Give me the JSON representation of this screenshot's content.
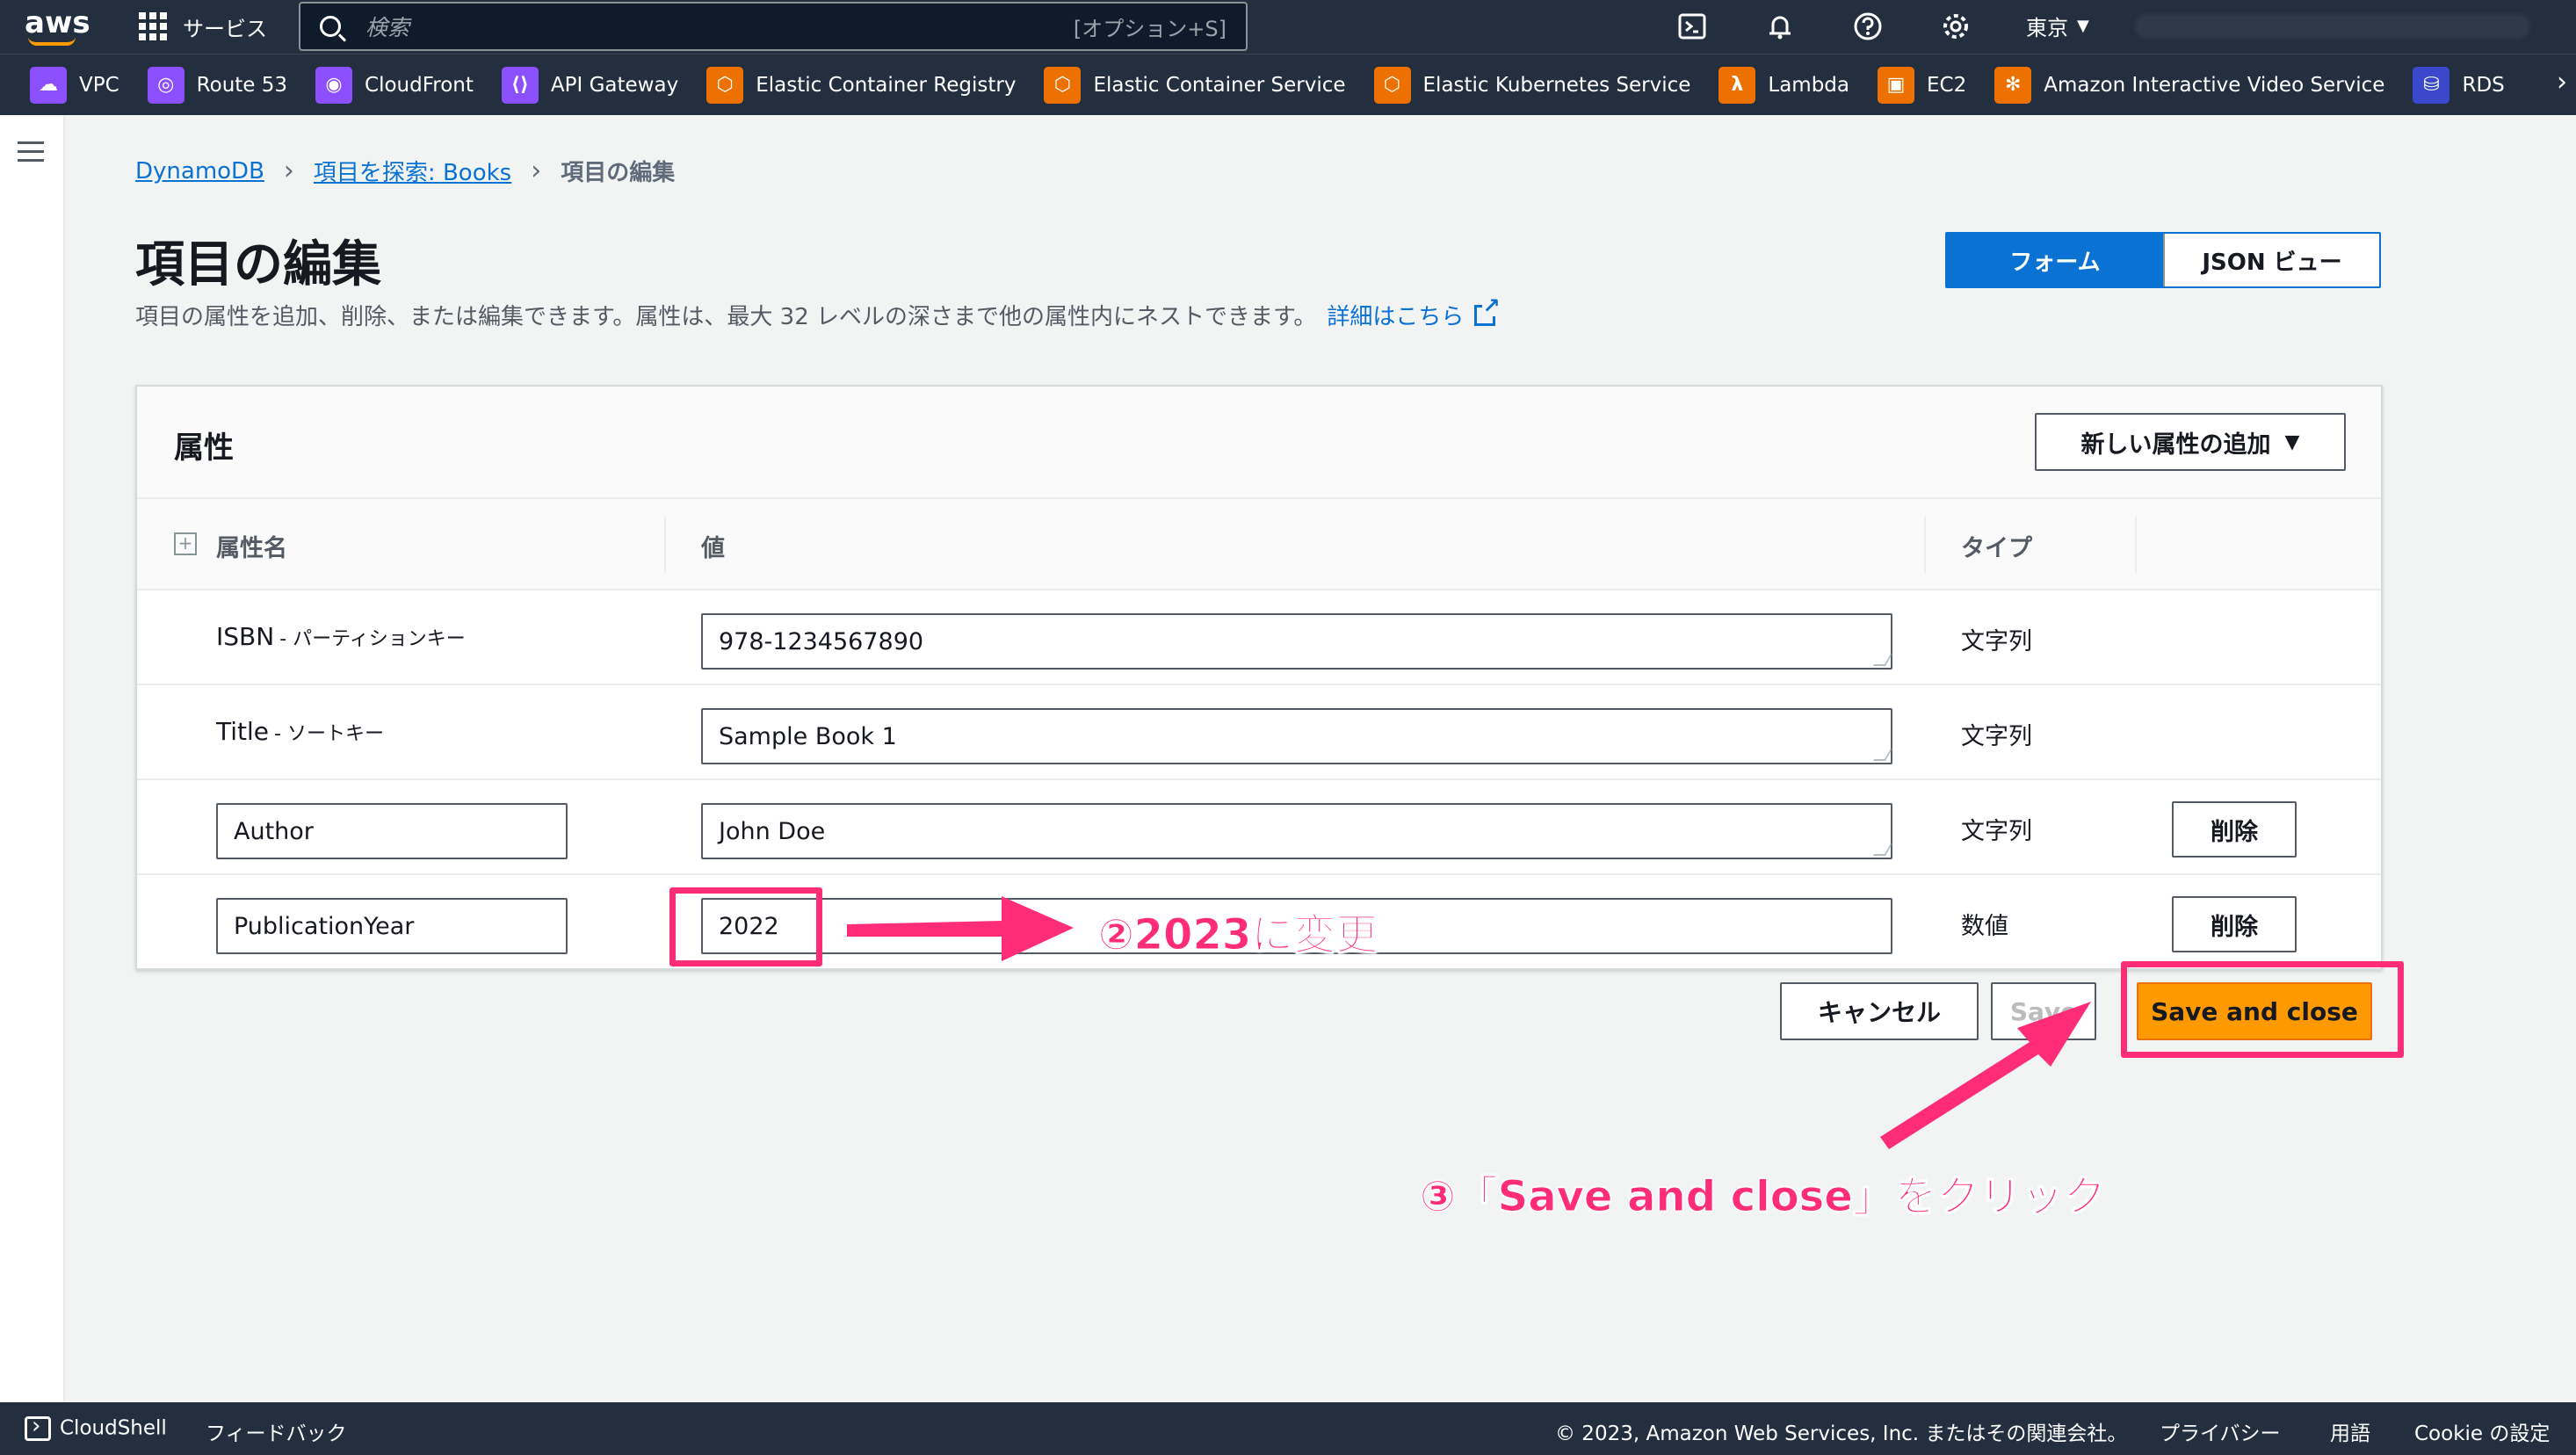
{
  "topnav": {
    "services_label": "サービス",
    "search_placeholder": "検索",
    "search_shortcut": "[オプション+S]",
    "region_label": "東京"
  },
  "favorites": [
    {
      "label": "VPC",
      "color": "#8c4fff",
      "icon": "vpc-icon"
    },
    {
      "label": "Route 53",
      "color": "#8c4fff",
      "icon": "route53-icon"
    },
    {
      "label": "CloudFront",
      "color": "#8c4fff",
      "icon": "cloudfront-icon"
    },
    {
      "label": "API Gateway",
      "color": "#8c4fff",
      "icon": "api-gateway-icon"
    },
    {
      "label": "Elastic Container Registry",
      "color": "#ed7100",
      "icon": "ecr-icon"
    },
    {
      "label": "Elastic Container Service",
      "color": "#ed7100",
      "icon": "ecs-icon"
    },
    {
      "label": "Elastic Kubernetes Service",
      "color": "#ed7100",
      "icon": "eks-icon"
    },
    {
      "label": "Lambda",
      "color": "#ed7100",
      "icon": "lambda-icon"
    },
    {
      "label": "EC2",
      "color": "#ed7100",
      "icon": "ec2-icon"
    },
    {
      "label": "Amazon Interactive Video Service",
      "color": "#ed7100",
      "icon": "ivs-icon"
    },
    {
      "label": "RDS",
      "color": "#3b48cc",
      "icon": "rds-icon"
    }
  ],
  "breadcrumb": {
    "root": "DynamoDB",
    "middle": "項目を探索: Books",
    "current": "項目の編集"
  },
  "page": {
    "title": "項目の編集",
    "description": "項目の属性を追加、削除、または編集できます。属性は、最大 32 レベルの深さまで他の属性内にネストできます。",
    "learn_more": "詳細はこちら"
  },
  "view_toggle": {
    "form": "フォーム",
    "json": "JSON ビュー",
    "selected": "フォーム"
  },
  "panel": {
    "title": "属性",
    "add_button": "新しい属性の追加",
    "columns": {
      "name": "属性名",
      "value": "値",
      "type": "タイプ"
    },
    "rows": [
      {
        "name": "ISBN",
        "key_label": "- パーティションキー",
        "value": "978-1234567890",
        "type": "文字列"
      },
      {
        "name": "Title",
        "key_label": "- ソートキー",
        "value": "Sample Book 1",
        "type": "文字列"
      },
      {
        "name": "Author",
        "value": "John Doe",
        "type": "文字列",
        "delete": "削除"
      },
      {
        "name": "PublicationYear",
        "value": "2022",
        "type": "数値",
        "delete": "削除"
      }
    ]
  },
  "actions": {
    "cancel": "キャンセル",
    "save": "Save",
    "save_and_close": "Save and close"
  },
  "annotations": {
    "step2": "②2023に変更",
    "step3": "③「Save and close」をクリック",
    "color": "#ff2d78"
  },
  "bottombar": {
    "cloudshell": "CloudShell",
    "feedback": "フィードバック",
    "copyright": "© 2023, Amazon Web Services, Inc. またはその関連会社。",
    "privacy": "プライバシー",
    "terms": "用語",
    "cookie": "Cookie の設定"
  }
}
